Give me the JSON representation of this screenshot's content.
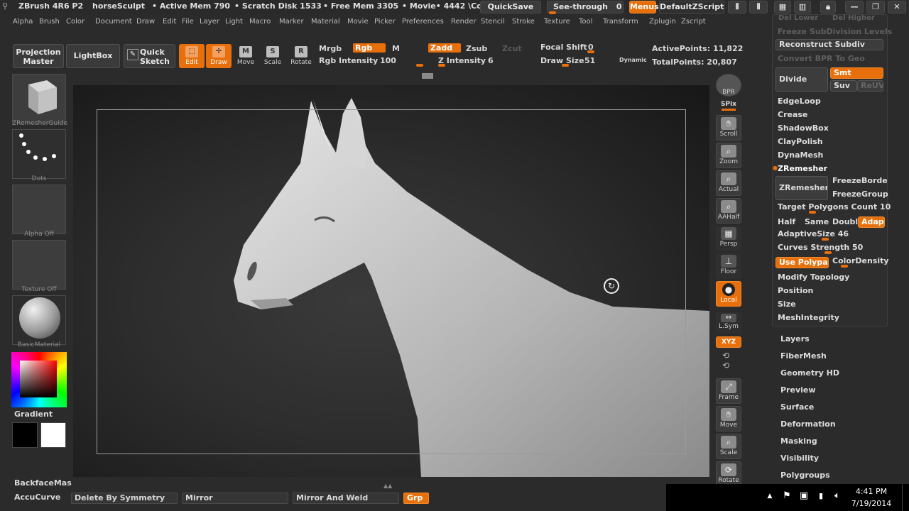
{
  "title_bar": {
    "app": "ZBrush 4R6 P2",
    "doc": "horseSculpt",
    "active_mem": "• Active Mem 790",
    "scratch": "• Scratch Disk 1533",
    "free_mem": "• Free Mem 3305",
    "movie": "• Movie• 4442 \\Cc",
    "quicksave": "QuickSave",
    "see_through": "See-through",
    "see_through_value": "0",
    "menus": "Menus",
    "default_zscript": "DefaultZScript"
  },
  "menu_bar": [
    "Alpha",
    "Brush",
    "Color",
    "Document",
    "Draw",
    "Edit",
    "File",
    "Layer",
    "Light",
    "Macro",
    "Marker",
    "Material",
    "Movie",
    "Picker",
    "Preferences",
    "Render",
    "Stencil",
    "Stroke",
    "Texture",
    "Tool",
    "Transform",
    "Zplugin",
    "Zscript"
  ],
  "toolbar": {
    "projection_master": "Projection Master",
    "lightbox": "LightBox",
    "quick_sketch": "Quick Sketch",
    "edit": "Edit",
    "draw": "Draw",
    "move": "Move",
    "scale": "Scale",
    "rotate": "Rotate",
    "mrgb": "Mrgb",
    "rgb": "Rgb",
    "m": "M",
    "zadd": "Zadd",
    "zsub": "Zsub",
    "zcut": "Zcut",
    "rgb_intensity_label": "Rgb Intensity",
    "rgb_intensity": "100",
    "z_intensity_label": "Z Intensity",
    "z_intensity": "6",
    "focal_shift_label": "Focal Shift",
    "focal_shift": "0",
    "draw_size_label": "Draw Size",
    "draw_size": "51",
    "dynamic": "Dynamic",
    "active_points": "ActivePoints: 11,822",
    "total_points": "TotalPoints: 20,807"
  },
  "left_shelf": {
    "tool_thumb_label": "ZRemesherGuide",
    "stroke_label": "Dots",
    "alpha_label": "Alpha Off",
    "texture_label": "Texture Off",
    "material_label": "BasicMaterial",
    "gradient": "Gradient"
  },
  "right_shelf": [
    {
      "icon": "bpr-icon",
      "label": "BPR"
    },
    {
      "icon": "spix-icon",
      "label": "SPix"
    },
    {
      "icon": "hand-icon",
      "label": "Scroll"
    },
    {
      "icon": "zoom-icon",
      "label": "Zoom"
    },
    {
      "icon": "actual-icon",
      "label": "Actual"
    },
    {
      "icon": "aahalf-icon",
      "label": "AAHalf"
    },
    {
      "icon": "persp-icon",
      "label": "Persp"
    },
    {
      "icon": "floor-icon",
      "label": "Floor"
    },
    {
      "icon": "local-icon",
      "label": "Local"
    },
    {
      "icon": "lsym-icon",
      "label": "L.Sym"
    },
    {
      "icon": "xyz-icon",
      "label": "XYZ"
    },
    {
      "icon": "frame-icon",
      "label": "Frame"
    },
    {
      "icon": "move-icon",
      "label": "Move"
    },
    {
      "icon": "scale-icon",
      "label": "Scale"
    },
    {
      "icon": "rotate-icon",
      "label": "Rotate"
    }
  ],
  "tray": {
    "del_lower": "Del Lower",
    "del_higher": "Del Higher",
    "freeze_subdiv": "Freeze SubDivision Levels",
    "reconstruct_subdiv": "Reconstruct Subdiv",
    "convert_bpr": "Convert BPR To Geo",
    "divide": "Divide",
    "smt": "Smt",
    "suv": "Suv",
    "rel_uv": "ReUV",
    "edgeloop": "EdgeLoop",
    "crease": "Crease",
    "shadowbox": "ShadowBox",
    "claypolish": "ClayPolish",
    "dynamesh": "DynaMesh",
    "zremesher_header": "ZRemesher",
    "zremesher_btn": "ZRemesher",
    "freeze_border": "FreezeBorde",
    "freeze_groups": "FreezeGroup",
    "target_polygons": "Target Polygons Count 10",
    "half": "Half",
    "same": "Same",
    "double": "Doubl",
    "adapt": "Adapt",
    "adaptive_size": "AdaptiveSize 46",
    "curves_strength": "Curves Strength 50",
    "use_polypaint": "Use Polypain",
    "color_density": "ColorDensity",
    "modify_topology": "Modify Topology",
    "position": "Position",
    "size": "Size",
    "mesh_integrity": "MeshIntegrity"
  },
  "subpalettes": [
    "Layers",
    "FiberMesh",
    "Geometry HD",
    "Preview",
    "Surface",
    "Deformation",
    "Masking",
    "Visibility",
    "Polygroups"
  ],
  "bottom_bar": {
    "backface": "BackfaceMas",
    "accucurve": "AccuCurve",
    "delete_by_symmetry": "Delete By Symmetry",
    "mirror": "Mirror",
    "mirror_and_weld": "Mirror And Weld",
    "grp": "Grp"
  },
  "taskbar": {
    "time": "4:41 PM",
    "date": "7/19/2014"
  },
  "colors": {
    "accent": "#e8700c",
    "panel": "#2b2b2b"
  }
}
